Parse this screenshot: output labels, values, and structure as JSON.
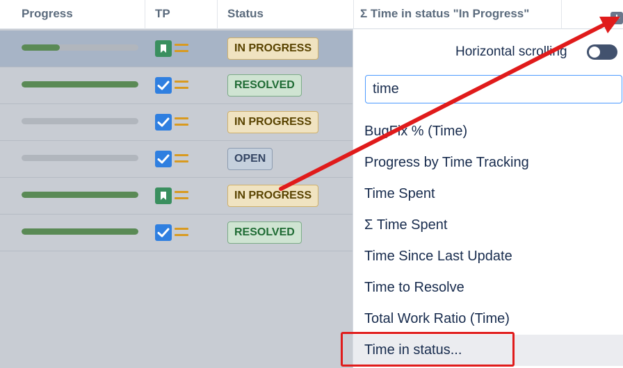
{
  "header": {
    "col_progress": "Progress",
    "col_tp": "TP",
    "col_status": "Status",
    "col_time": "Σ Time in status \"In Progress\"",
    "add_column_icon": "plus-icon"
  },
  "rows": [
    {
      "progress": 0.33,
      "type_icon": "story-icon",
      "priority_icon": "medium-priority-icon",
      "status": "IN PROGRESS"
    },
    {
      "progress": 1.0,
      "type_icon": "task-checkbox-icon",
      "priority_icon": "medium-priority-icon",
      "status": "RESOLVED"
    },
    {
      "progress": 0.0,
      "type_icon": "task-checkbox-icon",
      "priority_icon": "medium-priority-icon",
      "status": "IN PROGRESS"
    },
    {
      "progress": 0.0,
      "type_icon": "task-checkbox-icon",
      "priority_icon": "medium-priority-icon",
      "status": "OPEN"
    },
    {
      "progress": 1.0,
      "type_icon": "story-icon",
      "priority_icon": "medium-priority-icon",
      "status": "IN PROGRESS"
    },
    {
      "progress": 1.0,
      "type_icon": "task-checkbox-icon",
      "priority_icon": "medium-priority-icon",
      "status": "RESOLVED"
    }
  ],
  "panel": {
    "horizontal_scrolling_label": "Horizontal scrolling",
    "search_value": "time",
    "options": [
      "BugFix % (Time)",
      "Progress by Time Tracking",
      "Time Spent",
      "Σ Time Spent",
      "Time Since Last Update",
      "Time to Resolve",
      "Total Work Ratio (Time)",
      "Time in status..."
    ]
  },
  "colors": {
    "annotation_red": "#e01b1b",
    "progress_green": "#5a8a55",
    "story_green": "#3a8f5f",
    "task_blue": "#2f7fe0",
    "priority_amber": "#d99a1f"
  }
}
